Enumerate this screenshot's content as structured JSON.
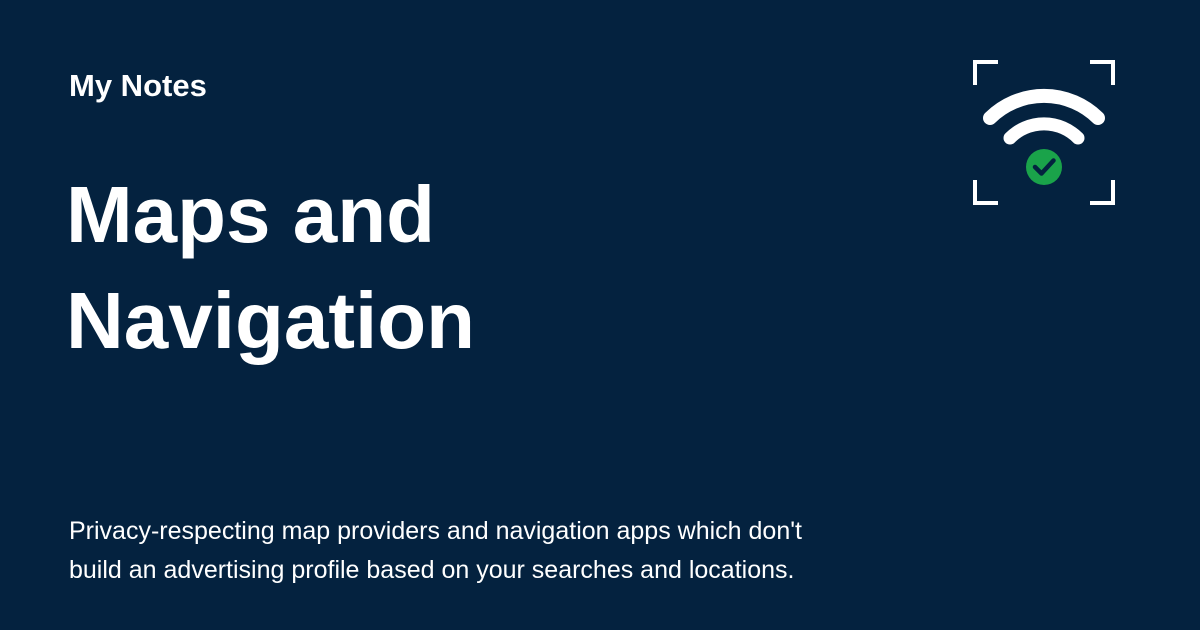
{
  "colors": {
    "background": "#04223f",
    "text": "#ffffff",
    "logo_stroke": "#ffffff",
    "check_badge": "#1aa34a"
  },
  "header": {
    "site_name": "My Notes"
  },
  "main": {
    "title_line_1": "Maps and",
    "title_line_2": "Navigation",
    "description_line_1": "Privacy-respecting map providers and navigation apps which don't",
    "description_line_2": "build an advertising profile based on your searches and locations."
  },
  "logo": {
    "icon": "wifi-check-icon"
  }
}
